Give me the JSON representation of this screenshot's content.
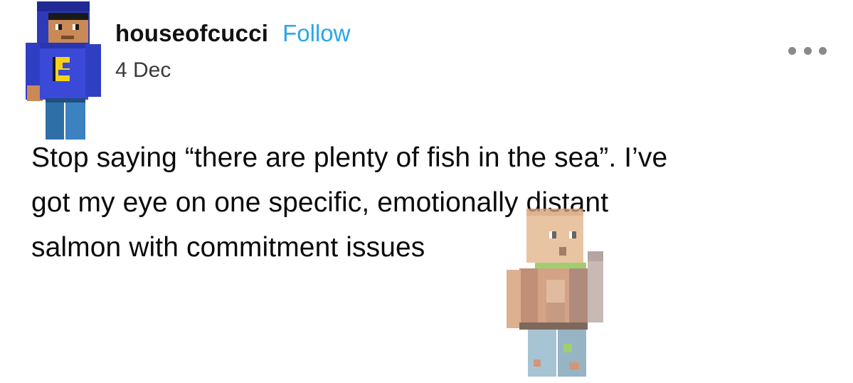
{
  "post": {
    "author": {
      "username": "houseofcucci",
      "follow_label": "Follow",
      "date": "4 Dec",
      "avatar_icon": "minecraft-skin-avatar-icon"
    },
    "more_menu_icon": "more-options-icon",
    "text_lines": [
      "Stop saying “there are plenty of fish in the sea”. I’ve",
      "got my eye on one specific, emotionally distant",
      "salmon with commitment issues"
    ],
    "sticker_icon": "minecraft-character-sticker-icon"
  },
  "colors": {
    "follow": "#2aa6e8",
    "text": "#0a0a0a",
    "more_dots": "#8a8a8a",
    "background": "#ffffff"
  }
}
